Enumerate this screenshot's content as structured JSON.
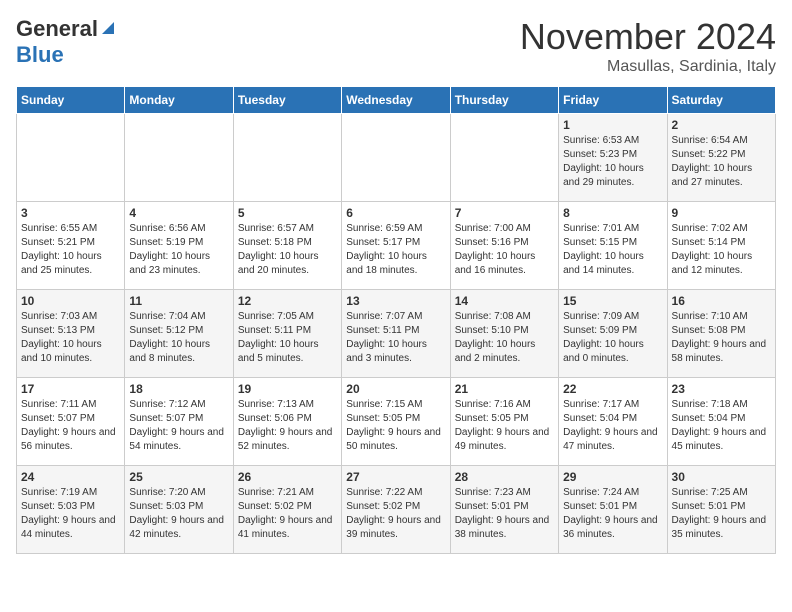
{
  "header": {
    "logo_line1": "General",
    "logo_line2": "Blue",
    "month": "November 2024",
    "location": "Masullas, Sardinia, Italy"
  },
  "days_of_week": [
    "Sunday",
    "Monday",
    "Tuesday",
    "Wednesday",
    "Thursday",
    "Friday",
    "Saturday"
  ],
  "weeks": [
    [
      {
        "day": "",
        "info": ""
      },
      {
        "day": "",
        "info": ""
      },
      {
        "day": "",
        "info": ""
      },
      {
        "day": "",
        "info": ""
      },
      {
        "day": "",
        "info": ""
      },
      {
        "day": "1",
        "info": "Sunrise: 6:53 AM\nSunset: 5:23 PM\nDaylight: 10 hours and 29 minutes."
      },
      {
        "day": "2",
        "info": "Sunrise: 6:54 AM\nSunset: 5:22 PM\nDaylight: 10 hours and 27 minutes."
      }
    ],
    [
      {
        "day": "3",
        "info": "Sunrise: 6:55 AM\nSunset: 5:21 PM\nDaylight: 10 hours and 25 minutes."
      },
      {
        "day": "4",
        "info": "Sunrise: 6:56 AM\nSunset: 5:19 PM\nDaylight: 10 hours and 23 minutes."
      },
      {
        "day": "5",
        "info": "Sunrise: 6:57 AM\nSunset: 5:18 PM\nDaylight: 10 hours and 20 minutes."
      },
      {
        "day": "6",
        "info": "Sunrise: 6:59 AM\nSunset: 5:17 PM\nDaylight: 10 hours and 18 minutes."
      },
      {
        "day": "7",
        "info": "Sunrise: 7:00 AM\nSunset: 5:16 PM\nDaylight: 10 hours and 16 minutes."
      },
      {
        "day": "8",
        "info": "Sunrise: 7:01 AM\nSunset: 5:15 PM\nDaylight: 10 hours and 14 minutes."
      },
      {
        "day": "9",
        "info": "Sunrise: 7:02 AM\nSunset: 5:14 PM\nDaylight: 10 hours and 12 minutes."
      }
    ],
    [
      {
        "day": "10",
        "info": "Sunrise: 7:03 AM\nSunset: 5:13 PM\nDaylight: 10 hours and 10 minutes."
      },
      {
        "day": "11",
        "info": "Sunrise: 7:04 AM\nSunset: 5:12 PM\nDaylight: 10 hours and 8 minutes."
      },
      {
        "day": "12",
        "info": "Sunrise: 7:05 AM\nSunset: 5:11 PM\nDaylight: 10 hours and 5 minutes."
      },
      {
        "day": "13",
        "info": "Sunrise: 7:07 AM\nSunset: 5:11 PM\nDaylight: 10 hours and 3 minutes."
      },
      {
        "day": "14",
        "info": "Sunrise: 7:08 AM\nSunset: 5:10 PM\nDaylight: 10 hours and 2 minutes."
      },
      {
        "day": "15",
        "info": "Sunrise: 7:09 AM\nSunset: 5:09 PM\nDaylight: 10 hours and 0 minutes."
      },
      {
        "day": "16",
        "info": "Sunrise: 7:10 AM\nSunset: 5:08 PM\nDaylight: 9 hours and 58 minutes."
      }
    ],
    [
      {
        "day": "17",
        "info": "Sunrise: 7:11 AM\nSunset: 5:07 PM\nDaylight: 9 hours and 56 minutes."
      },
      {
        "day": "18",
        "info": "Sunrise: 7:12 AM\nSunset: 5:07 PM\nDaylight: 9 hours and 54 minutes."
      },
      {
        "day": "19",
        "info": "Sunrise: 7:13 AM\nSunset: 5:06 PM\nDaylight: 9 hours and 52 minutes."
      },
      {
        "day": "20",
        "info": "Sunrise: 7:15 AM\nSunset: 5:05 PM\nDaylight: 9 hours and 50 minutes."
      },
      {
        "day": "21",
        "info": "Sunrise: 7:16 AM\nSunset: 5:05 PM\nDaylight: 9 hours and 49 minutes."
      },
      {
        "day": "22",
        "info": "Sunrise: 7:17 AM\nSunset: 5:04 PM\nDaylight: 9 hours and 47 minutes."
      },
      {
        "day": "23",
        "info": "Sunrise: 7:18 AM\nSunset: 5:04 PM\nDaylight: 9 hours and 45 minutes."
      }
    ],
    [
      {
        "day": "24",
        "info": "Sunrise: 7:19 AM\nSunset: 5:03 PM\nDaylight: 9 hours and 44 minutes."
      },
      {
        "day": "25",
        "info": "Sunrise: 7:20 AM\nSunset: 5:03 PM\nDaylight: 9 hours and 42 minutes."
      },
      {
        "day": "26",
        "info": "Sunrise: 7:21 AM\nSunset: 5:02 PM\nDaylight: 9 hours and 41 minutes."
      },
      {
        "day": "27",
        "info": "Sunrise: 7:22 AM\nSunset: 5:02 PM\nDaylight: 9 hours and 39 minutes."
      },
      {
        "day": "28",
        "info": "Sunrise: 7:23 AM\nSunset: 5:01 PM\nDaylight: 9 hours and 38 minutes."
      },
      {
        "day": "29",
        "info": "Sunrise: 7:24 AM\nSunset: 5:01 PM\nDaylight: 9 hours and 36 minutes."
      },
      {
        "day": "30",
        "info": "Sunrise: 7:25 AM\nSunset: 5:01 PM\nDaylight: 9 hours and 35 minutes."
      }
    ]
  ]
}
